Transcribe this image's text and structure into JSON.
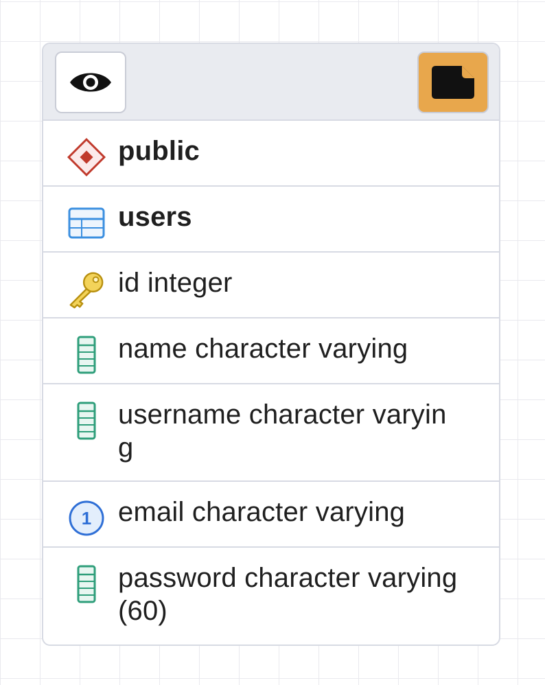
{
  "header": {
    "left_button": {
      "icon": "eye-icon"
    },
    "right_button": {
      "icon": "note-icon",
      "color": "#e8a74c"
    }
  },
  "rows": [
    {
      "icon": "schema-icon",
      "text": "public",
      "bold": true
    },
    {
      "icon": "table-icon",
      "text": "users",
      "bold": true
    },
    {
      "icon": "primary-key-icon",
      "text": "id integer",
      "bold": false
    },
    {
      "icon": "column-icon",
      "text": "name character varying",
      "bold": false
    },
    {
      "icon": "column-icon",
      "text": "username character varyin\ng",
      "bold": false
    },
    {
      "icon": "unique-key-icon",
      "text": "email character varying",
      "bold": false
    },
    {
      "icon": "column-icon",
      "text": "password character varying\n(60)",
      "bold": false
    }
  ],
  "colors": {
    "schema": "#c0392b",
    "table": "#3b8fe0",
    "key": "#e6c12e",
    "column": "#2e9e7a",
    "unique": "#2f6fd6",
    "header_bg": "#e9ebf0"
  }
}
